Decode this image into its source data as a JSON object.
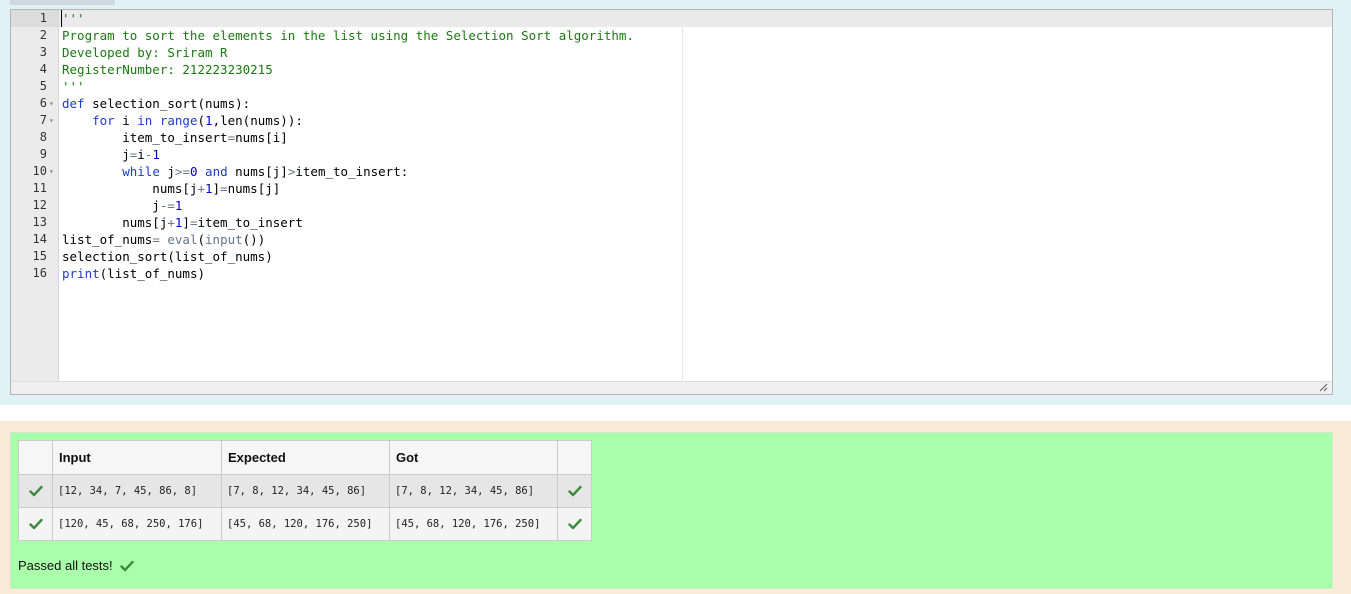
{
  "editor": {
    "lines": [
      {
        "n": "1",
        "fold": false,
        "tokens": [
          {
            "t": "'''",
            "c": "c-str"
          }
        ]
      },
      {
        "n": "2",
        "fold": false,
        "tokens": [
          {
            "t": "Program to sort the elements in the list using the Selection Sort algorithm.",
            "c": "c-str"
          }
        ]
      },
      {
        "n": "3",
        "fold": false,
        "tokens": [
          {
            "t": "Developed by: Sriram R",
            "c": "c-str"
          }
        ]
      },
      {
        "n": "4",
        "fold": false,
        "tokens": [
          {
            "t": "RegisterNumber: 212223230215",
            "c": "c-str"
          }
        ]
      },
      {
        "n": "5",
        "fold": false,
        "tokens": [
          {
            "t": "'''",
            "c": "c-str"
          }
        ]
      },
      {
        "n": "6",
        "fold": true,
        "tokens": [
          {
            "t": "def",
            "c": "c-kw"
          },
          {
            "t": " selection_sort(nums):",
            "c": "c-plain"
          }
        ]
      },
      {
        "n": "7",
        "fold": true,
        "tokens": [
          {
            "t": "    ",
            "c": "c-plain"
          },
          {
            "t": "for",
            "c": "c-kw"
          },
          {
            "t": " i ",
            "c": "c-plain"
          },
          {
            "t": "in",
            "c": "c-kw"
          },
          {
            "t": " ",
            "c": "c-plain"
          },
          {
            "t": "range",
            "c": "c-fn"
          },
          {
            "t": "(",
            "c": "c-plain"
          },
          {
            "t": "1",
            "c": "c-num"
          },
          {
            "t": ",len(nums)):",
            "c": "c-plain"
          }
        ]
      },
      {
        "n": "8",
        "fold": false,
        "tokens": [
          {
            "t": "        item_to_insert",
            "c": "c-plain"
          },
          {
            "t": "=",
            "c": "c-op"
          },
          {
            "t": "nums[i]",
            "c": "c-plain"
          }
        ]
      },
      {
        "n": "9",
        "fold": false,
        "tokens": [
          {
            "t": "        j",
            "c": "c-plain"
          },
          {
            "t": "=",
            "c": "c-op"
          },
          {
            "t": "i",
            "c": "c-plain"
          },
          {
            "t": "-",
            "c": "c-op"
          },
          {
            "t": "1",
            "c": "c-num"
          }
        ]
      },
      {
        "n": "10",
        "fold": true,
        "tokens": [
          {
            "t": "        ",
            "c": "c-plain"
          },
          {
            "t": "while",
            "c": "c-kw"
          },
          {
            "t": " j",
            "c": "c-plain"
          },
          {
            "t": ">=",
            "c": "c-op"
          },
          {
            "t": "0",
            "c": "c-num"
          },
          {
            "t": " ",
            "c": "c-plain"
          },
          {
            "t": "and",
            "c": "c-kw"
          },
          {
            "t": " nums[j]",
            "c": "c-plain"
          },
          {
            "t": ">",
            "c": "c-op"
          },
          {
            "t": "item_to_insert:",
            "c": "c-plain"
          }
        ]
      },
      {
        "n": "11",
        "fold": false,
        "tokens": [
          {
            "t": "            nums[j",
            "c": "c-plain"
          },
          {
            "t": "+",
            "c": "c-op"
          },
          {
            "t": "1",
            "c": "c-num"
          },
          {
            "t": "]",
            "c": "c-plain"
          },
          {
            "t": "=",
            "c": "c-op"
          },
          {
            "t": "nums[j]",
            "c": "c-plain"
          }
        ]
      },
      {
        "n": "12",
        "fold": false,
        "tokens": [
          {
            "t": "            j",
            "c": "c-plain"
          },
          {
            "t": "-=",
            "c": "c-op"
          },
          {
            "t": "1",
            "c": "c-num"
          }
        ]
      },
      {
        "n": "13",
        "fold": false,
        "tokens": [
          {
            "t": "        nums[j",
            "c": "c-plain"
          },
          {
            "t": "+",
            "c": "c-op"
          },
          {
            "t": "1",
            "c": "c-num"
          },
          {
            "t": "]",
            "c": "c-plain"
          },
          {
            "t": "=",
            "c": "c-op"
          },
          {
            "t": "item_to_insert",
            "c": "c-plain"
          }
        ]
      },
      {
        "n": "14",
        "fold": false,
        "tokens": [
          {
            "t": "list_of_nums",
            "c": "c-plain"
          },
          {
            "t": "=",
            "c": "c-op"
          },
          {
            "t": " ",
            "c": "c-plain"
          },
          {
            "t": "eval",
            "c": "c-op"
          },
          {
            "t": "(",
            "c": "c-plain"
          },
          {
            "t": "input",
            "c": "c-op"
          },
          {
            "t": "())",
            "c": "c-plain"
          }
        ]
      },
      {
        "n": "15",
        "fold": false,
        "tokens": [
          {
            "t": "selection_sort(list_of_nums)",
            "c": "c-plain"
          }
        ]
      },
      {
        "n": "16",
        "fold": false,
        "tokens": [
          {
            "t": "print",
            "c": "c-fn"
          },
          {
            "t": "(list_of_nums)",
            "c": "c-plain"
          }
        ]
      }
    ]
  },
  "results": {
    "headers": {
      "blank": "",
      "input": "Input",
      "expected": "Expected",
      "got": "Got",
      "blank2": ""
    },
    "rows": [
      {
        "status": "pass",
        "input": "[12, 34, 7, 45, 86, 8]",
        "expected": "[7, 8, 12, 34, 45, 86]",
        "got": "[7, 8, 12, 34, 45, 86]"
      },
      {
        "status": "pass",
        "input": "[120, 45, 68, 250, 176]",
        "expected": "[45, 68, 120, 176, 250]",
        "got": "[45, 68, 120, 176, 250]"
      }
    ],
    "summary": "Passed all tests!"
  },
  "icons": {
    "pass": "checkmark-icon",
    "resize": "resize-grip-icon"
  },
  "colors": {
    "pass_green": "#3c8a3c",
    "result_bg": "#aaffaa",
    "answer_bg": "#e0f1f7",
    "outer_bg": "#faebd7"
  }
}
